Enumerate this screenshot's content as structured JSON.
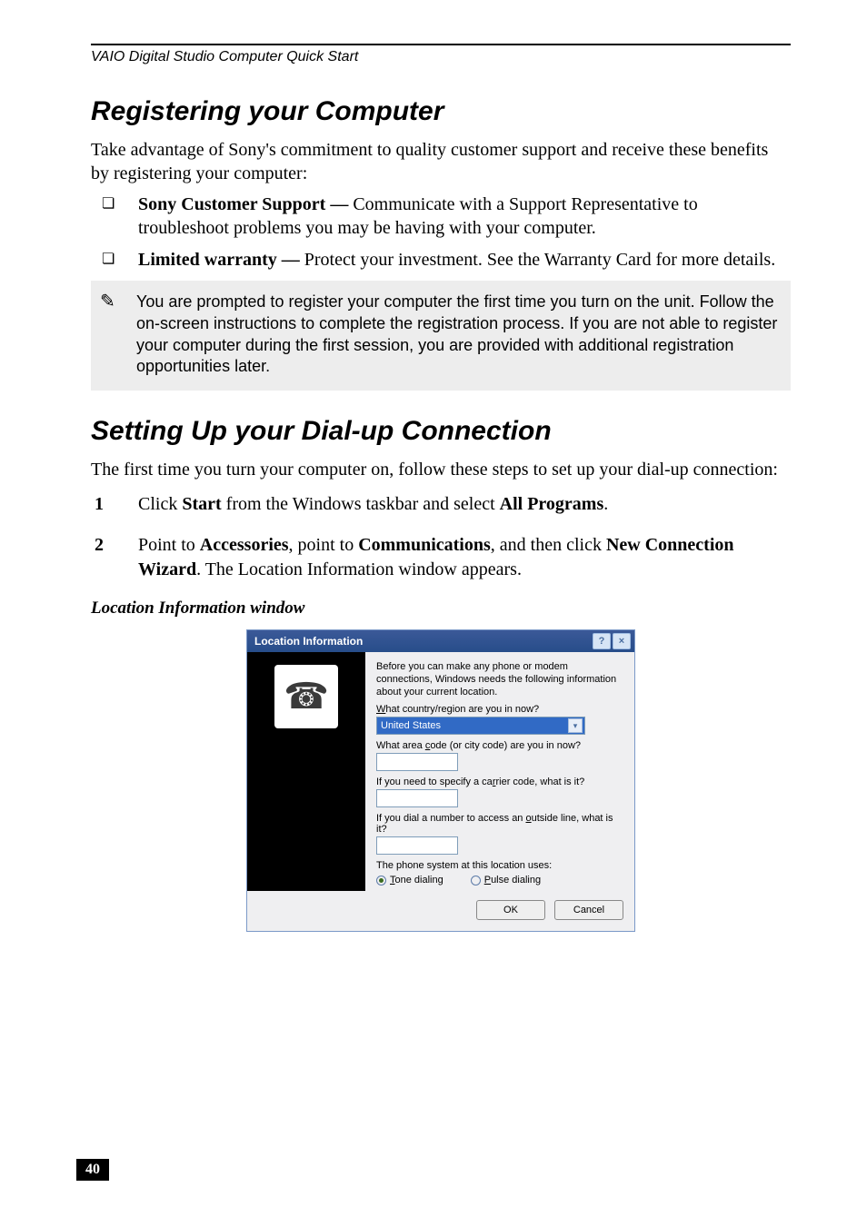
{
  "running_head": "VAIO Digital Studio Computer Quick Start",
  "section1": {
    "heading": "Registering your Computer",
    "intro": "Take advantage of Sony's commitment to quality customer support and receive these benefits by registering your computer:",
    "bullet1_bold": "Sony Customer Support — ",
    "bullet1_rest": "Communicate with a Support Representative to troubleshoot problems you may be having with your computer.",
    "bullet2_bold": "Limited warranty — ",
    "bullet2_rest": "Protect your investment. See the Warranty Card for more details.",
    "note_icon": "✎",
    "note": "You are prompted to register your computer the first time you turn on the unit. Follow the on-screen instructions to complete the registration process. If you are not able to register your computer during the first session, you are provided with additional registration opportunities later."
  },
  "section2": {
    "heading": "Setting Up your Dial-up Connection",
    "intro": "The first time you turn your computer on, follow these steps to set up your dial-up connection:",
    "step1_pre": "Click ",
    "step1_b1": "Start",
    "step1_mid": " from the Windows taskbar and select ",
    "step1_b2": "All Programs",
    "step1_post": ".",
    "step2_pre": "Point to ",
    "step2_b1": "Accessories",
    "step2_m1": ", point to ",
    "step2_b2": "Communications",
    "step2_m2": ", and then click ",
    "step2_b3": "New Connection Wizard",
    "step2_post": ". The Location Information window appears.",
    "caption": "Location Information window"
  },
  "dialog": {
    "title": "Location Information",
    "help": "?",
    "close": "×",
    "intro": "Before you can make any phone or modem connections, Windows needs the following information about your current location.",
    "q1_pre": "",
    "q1_u": "W",
    "q1_post": "hat country/region are you in now?",
    "country": "United States",
    "q2_pre": "What area ",
    "q2_u": "c",
    "q2_post": "ode (or city code) are you in now?",
    "q3_pre": "If you need to specify a ca",
    "q3_u": "r",
    "q3_post": "rier code, what is it?",
    "q4_pre": "If you dial a number to access an ",
    "q4_u": "o",
    "q4_post": "utside line, what is it?",
    "q5": "The phone system at this location uses:",
    "radio1_u": "T",
    "radio1_post": "one dialing",
    "radio2_u": "P",
    "radio2_post": "ulse dialing",
    "ok": "OK",
    "cancel": "Cancel"
  },
  "page_number": "40"
}
